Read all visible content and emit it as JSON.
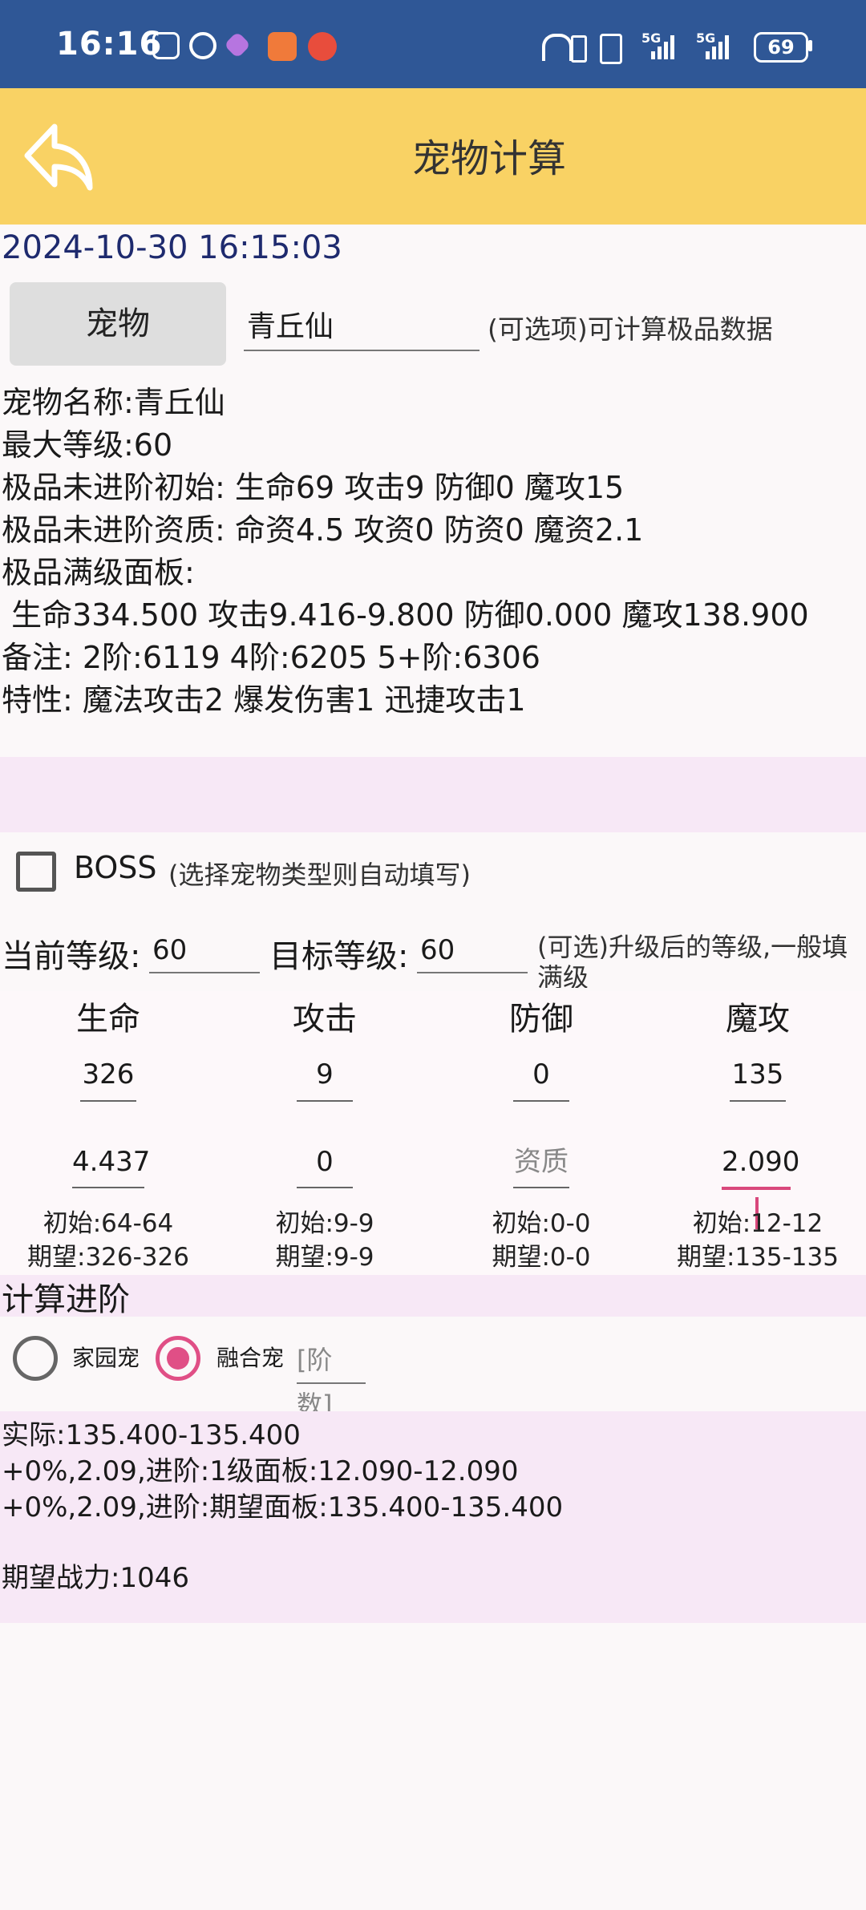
{
  "status_bar": {
    "time": "16:16",
    "battery": "69",
    "net1": "5G",
    "net2": "5G"
  },
  "header": {
    "title": "宠物计算"
  },
  "datetime": "2024-10-30 16:15:03",
  "pet": {
    "button_label": "宠物",
    "input_value": "青丘仙",
    "optional_hint": "(可选项)可计算极品数据"
  },
  "info_lines": [
    "宠物名称:青丘仙",
    "最大等级:60",
    "极品未进阶初始: 生命69 攻击9 防御0 魔攻15",
    "极品未进阶资质: 命资4.5 攻资0 防资0 魔资2.1",
    "极品满级面板:",
    " 生命334.500 攻击9.416-9.800 防御0.000 魔攻138.900",
    "备注: 2阶:6119 4阶:6205 5+阶:6306",
    "特性: 魔法攻击2 爆发伤害1 迅捷攻击1"
  ],
  "boss": {
    "label": "BOSS",
    "hint": "(选择宠物类型则自动填写)",
    "checked": false
  },
  "levels": {
    "current_label": "当前等级:",
    "current_value": "60",
    "target_label": "目标等级:",
    "target_value": "60",
    "hint": "(可选)升级后的等级,一般填满级"
  },
  "stats": [
    {
      "header": "生命",
      "value": "326",
      "quality": "4.437",
      "quality_placeholder": "",
      "initial": "初始:64-64",
      "expected": "期望:326-326"
    },
    {
      "header": "攻击",
      "value": "9",
      "quality": "0",
      "quality_placeholder": "",
      "initial": "初始:9-9",
      "expected": "期望:9-9"
    },
    {
      "header": "防御",
      "value": "0",
      "quality": "",
      "quality_placeholder": "资质",
      "initial": "初始:0-0",
      "expected": "期望:0-0"
    },
    {
      "header": "魔攻",
      "value": "135",
      "quality": "2.090",
      "quality_placeholder": "",
      "initial": "初始:12-12",
      "expected": "期望:135-135"
    }
  ],
  "advance": {
    "title": "计算进阶",
    "option_home": "家园宠",
    "option_fusion": "融合宠",
    "selected": "融合宠",
    "stage_placeholder": "[阶数]"
  },
  "results": [
    "实际:135.400-135.400",
    "+0%,2.09,进阶:1级面板:12.090-12.090",
    "+0%,2.09,进阶:期望面板:135.400-135.400",
    "",
    "期望战力:1046"
  ],
  "colors": {
    "status_bar": "#2f5796",
    "header": "#f9d264",
    "accent": "#e04f86",
    "band": "#f7e8f6"
  }
}
